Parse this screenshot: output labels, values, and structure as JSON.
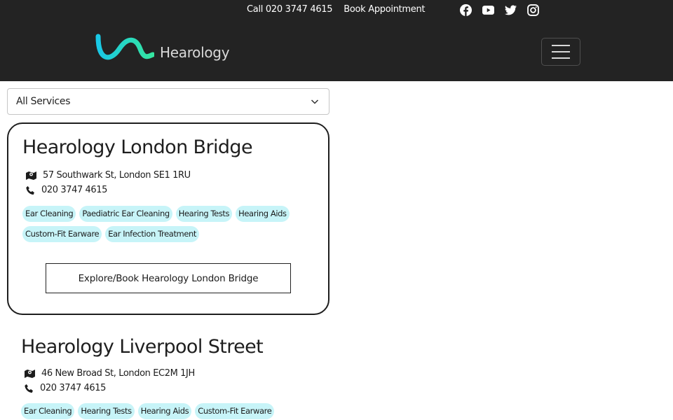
{
  "topbar": {
    "call_label": "Call 020 3747 4615",
    "book_label": "Book Appointment",
    "social_icons": [
      "facebook-icon",
      "youtube-icon",
      "twitter-icon",
      "instagram-icon"
    ]
  },
  "logo": {
    "text": "Hearology"
  },
  "filter": {
    "selected": "All Services"
  },
  "clinics": [
    {
      "name": "Hearology London Bridge",
      "address": "57 Southwark St, London SE1 1RU",
      "phone": "020 3747 4615",
      "services": [
        "Ear Cleaning",
        "Paediatric Ear Cleaning",
        "Hearing Tests",
        "Hearing Aids",
        "Custom-Fit Earware",
        "Ear Infection Treatment"
      ],
      "cta": "Explore/Book Hearology London Bridge"
    },
    {
      "name": "Hearology Liverpool Street",
      "address": "46 New Broad St, London EC2M 1JH",
      "phone": "020 3747 4615",
      "services": [
        "Ear Cleaning",
        "Hearing Tests",
        "Hearing Aids",
        "Custom-Fit Earware"
      ]
    }
  ],
  "colors": {
    "header_bg": "#232323",
    "chip_bg": "#c7f4f8",
    "logo_gradient_start": "#19c8e6",
    "logo_gradient_end": "#35e6a0"
  }
}
